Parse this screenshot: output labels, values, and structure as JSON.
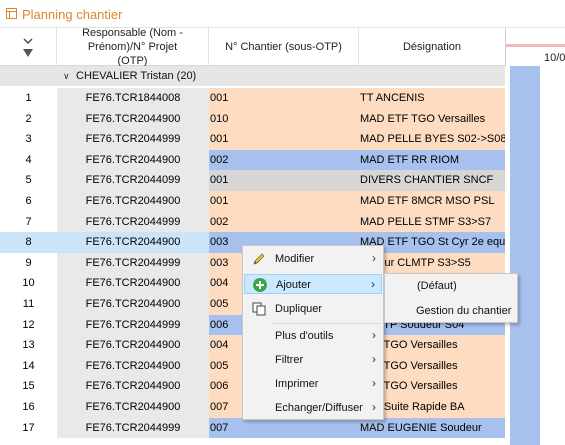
{
  "window": {
    "title": "Planning chantier"
  },
  "table": {
    "columns": {
      "responsable": "Responsable (Nom - Prénom)/N° Projet (OTP)",
      "chantier": "N° Chantier (sous-OTP)",
      "designation": "Désignation"
    },
    "group": {
      "label": "CHEVALIER Tristan (20)"
    },
    "rows": [
      {
        "num": "1",
        "otp": "FE76.TCR1844008",
        "chantier": "001",
        "designation": "TT ANCENIS",
        "tint": "peach"
      },
      {
        "num": "2",
        "otp": "FE76.TCR2044900",
        "chantier": "010",
        "designation": "MAD ETF TGO Versailles",
        "tint": "peach"
      },
      {
        "num": "3",
        "otp": "FE76.TCR2044999",
        "chantier": "001",
        "designation": "MAD PELLE BYES S02->S08",
        "tint": "peach"
      },
      {
        "num": "4",
        "otp": "FE76.TCR2044900",
        "chantier": "002",
        "designation": "MAD ETF RR RIOM",
        "tint": "blue"
      },
      {
        "num": "5",
        "otp": "FE76.TCR2044099",
        "chantier": "001",
        "designation": "DIVERS CHANTIER SNCF",
        "tint": "grey"
      },
      {
        "num": "6",
        "otp": "FE76.TCR2044900",
        "chantier": "001",
        "designation": "MAD ETF 8MCR MSO PSL",
        "tint": "peach"
      },
      {
        "num": "7",
        "otp": "FE76.TCR2044999",
        "chantier": "002",
        "designation": "MAD PELLE STMF S3>S7",
        "tint": "peach"
      },
      {
        "num": "8",
        "otp": "FE76.TCR2044900",
        "chantier": "003",
        "designation": "MAD ETF TGO St Cyr 2e equip",
        "tint": "blue",
        "selected": true
      },
      {
        "num": "9",
        "otp": "FE76.TCR2044999",
        "chantier": "003",
        "designation": "Pelleur CLMTP S3>S5",
        "tint": "peach"
      },
      {
        "num": "10",
        "otp": "FE76.TCR2044900",
        "chantier": "004",
        "designation": "",
        "tint": "peach"
      },
      {
        "num": "11",
        "otp": "FE76.TCR2044900",
        "chantier": "005",
        "designation": "",
        "tint": "peach"
      },
      {
        "num": "12",
        "otp": "FE76.TCR2044999",
        "chantier": "006",
        "designation": "CLMTP Soudeur S04",
        "tint": "blue"
      },
      {
        "num": "13",
        "otp": "FE76.TCR2044900",
        "chantier": "004",
        "designation": "ETF TGO Versailles",
        "tint": "peach"
      },
      {
        "num": "14",
        "otp": "FE76.TCR2044900",
        "chantier": "005",
        "designation": "ETF TGO Versailles",
        "tint": "peach"
      },
      {
        "num": "15",
        "otp": "FE76.TCR2044900",
        "chantier": "006",
        "designation": "ETF TGO Versailles",
        "tint": "peach"
      },
      {
        "num": "16",
        "otp": "FE76.TCR2044900",
        "chantier": "007",
        "designation": "ETF Suite Rapide BA",
        "tint": "peach"
      },
      {
        "num": "17",
        "otp": "FE76.TCR2044999",
        "chantier": "007",
        "designation": "MAD EUGENIE Soudeur",
        "tint": "blue"
      }
    ]
  },
  "gantt": {
    "date_label": "10/0"
  },
  "context_menu": {
    "items": [
      {
        "label": "Modifier",
        "icon": "pencil-icon",
        "submenu": true
      },
      {
        "label": "Ajouter",
        "icon": "plus-circle-icon",
        "submenu": true,
        "highlighted": true
      },
      {
        "label": "Dupliquer",
        "icon": "copy-icon",
        "submenu": false
      },
      {
        "label": "Plus d'outils",
        "icon": "",
        "submenu": true
      },
      {
        "label": "Filtrer",
        "icon": "",
        "submenu": true
      },
      {
        "label": "Imprimer",
        "icon": "",
        "submenu": true
      },
      {
        "label": "Echanger/Diffuser",
        "icon": "",
        "submenu": true
      }
    ],
    "submenu": {
      "items": [
        "(Défaut)",
        "Gestion du chantier"
      ]
    }
  },
  "colors": {
    "peach": "#fddcc2",
    "blue": "#a7c1ee",
    "grey": "#d6d6d6",
    "title": "#d98a26",
    "highlight": "#cce8ff"
  }
}
